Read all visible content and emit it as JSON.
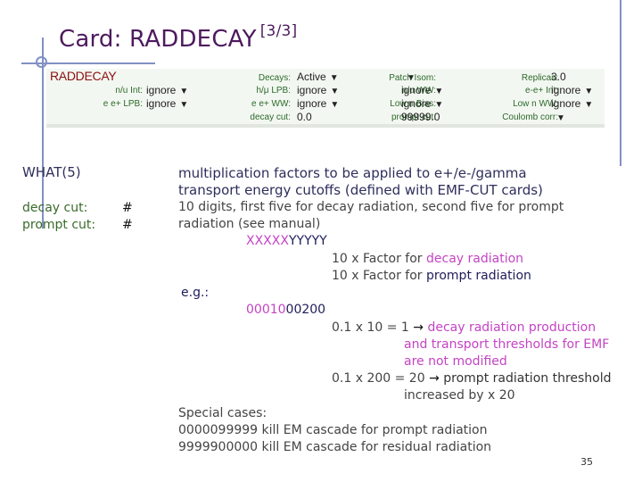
{
  "slide": {
    "title": "Card: RADDECAY",
    "title_suffix": "[3/3]",
    "page_number": "35"
  },
  "panel": {
    "name": "RADDECAY",
    "fields": [
      {
        "label": "n/u Int:",
        "value": "ignore",
        "dropdown": true
      },
      {
        "label": "e e+ LPB:",
        "value": "ignore",
        "dropdown": true
      },
      {
        "label": "Decays:",
        "value": "Active",
        "dropdown": true
      },
      {
        "label": "h/μ LPB:",
        "value": "ignore",
        "dropdown": true
      },
      {
        "label": "e e+ WW:",
        "value": "ignore",
        "dropdown": true
      },
      {
        "label": "decay cut:",
        "value": "0.0",
        "dropdown": false
      },
      {
        "label": "Patch Isom:",
        "value": "",
        "dropdown": true
      },
      {
        "label": "n/u WW:",
        "value": "ignore",
        "dropdown": true
      },
      {
        "label": "Low n Bias:",
        "value": "ignore",
        "dropdown": true
      },
      {
        "label": "prompt cut:",
        "value": "99999.0",
        "dropdown": false
      },
      {
        "label": "Replicas:",
        "value": "3.0",
        "dropdown": false
      },
      {
        "label": "e-e+ Int:",
        "value": "ignore",
        "dropdown": true
      },
      {
        "label": "Low n WW:",
        "value": "ignore",
        "dropdown": true
      },
      {
        "label": "Coulomb corr:",
        "value": "",
        "dropdown": true
      }
    ],
    "dropdown_glyph": "▼"
  },
  "left": {
    "heading": "WHAT(5)",
    "rows": [
      {
        "label": "decay cut:",
        "value": "#"
      },
      {
        "label": "prompt cut:",
        "value": "#"
      }
    ]
  },
  "body": {
    "desc_line1": "multiplication factors to be applied to e+/e-/gamma",
    "desc_line2": "transport energy cutoffs (defined with EMF-CUT cards)",
    "digits_line1": "10 digits, first five for decay radiation, second five for prompt",
    "digits_line2": "radiation (see manual)",
    "pattern_x": "XXXXX",
    "pattern_y": "YYYYY",
    "factor_prefix": "10 x Factor for ",
    "factor_decay": "decay radiation",
    "factor_prompt": "prompt radiation",
    "eg_label": "e.g.:",
    "example_decay": "00010",
    "example_prompt": "00200",
    "calc1_prefix": "0.1 x 10 = 1 ",
    "arrow": "→",
    "calc1_line1": " decay radiation production",
    "calc1_line2": "and transport thresholds for EMF",
    "calc1_line3": "are not modified",
    "calc2_prefix": "0.1 x 200 = 20 ",
    "calc2_line1": " prompt radiation threshold",
    "calc2_line2": "increased by x 20",
    "special_heading": "Special cases:",
    "special1": "0000099999 kill EM cascade for prompt radiation",
    "special2": "9999900000 kill EM cascade for residual radiation"
  }
}
